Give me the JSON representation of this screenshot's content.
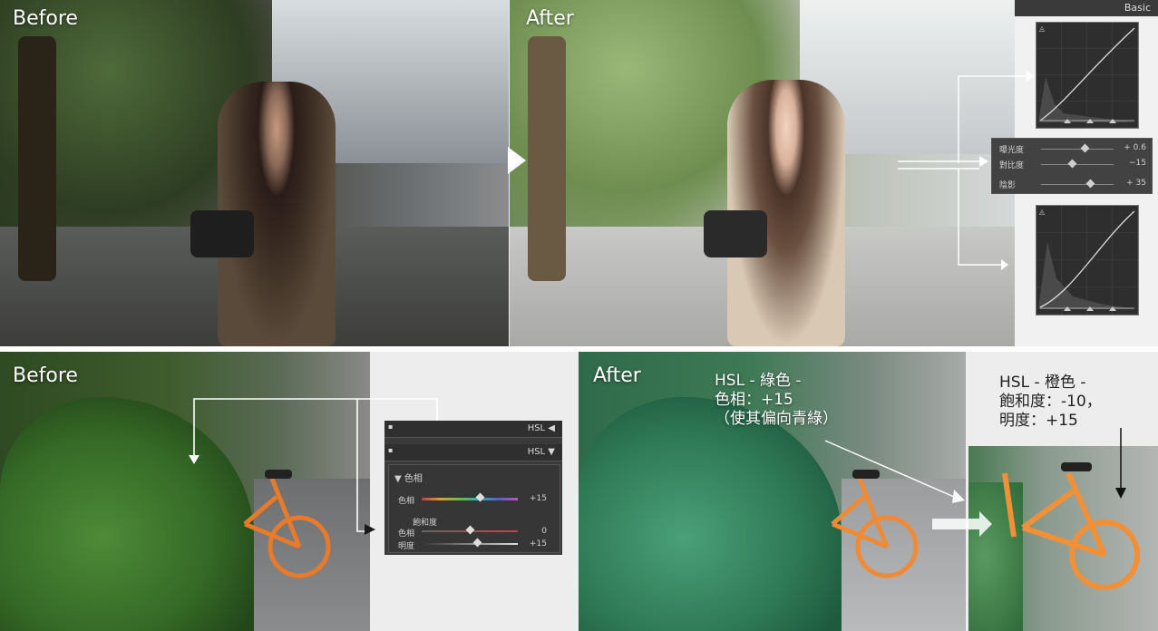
{
  "top": {
    "before_label": "Before",
    "after_label": "After",
    "panel_header": "Basic",
    "sliders": [
      {
        "name": "曝光度",
        "value": "+ 0.6",
        "level": 0.6
      },
      {
        "name": "對比度",
        "value": "−15",
        "level": 0.42
      },
      {
        "name": "陰影",
        "value": "+ 35",
        "level": 0.68
      }
    ]
  },
  "bottom": {
    "before_label": "Before",
    "after_label": "After",
    "hsl_panel": {
      "bar1_label": "HSL ◀",
      "bar2_label": "HSL ▼",
      "section_label": "▼  色相",
      "hue_label": "色相",
      "hue_value": "+15",
      "hue_level": 0.6,
      "sat_section": "飽和度",
      "sat_hue_label": "色相",
      "sat_hue_value": "0",
      "sat_level": 0.5,
      "lum_label": "明度",
      "lum_value": "+15",
      "lum_level": 0.58
    },
    "annotation_green": "HSL - 綠色 -\n色相：+15\n（使其偏向青綠）",
    "annotation_orange": "HSL - 橙色 -\n飽和度：-10，\n明度：+15"
  },
  "colors": {
    "panel_bg": "#3a3a3a",
    "arrow": "#ffffff",
    "hue_gradient": [
      "#c83a3a",
      "#e0a030",
      "#60c040",
      "#30b0c0",
      "#5060d0",
      "#c050c0"
    ]
  }
}
